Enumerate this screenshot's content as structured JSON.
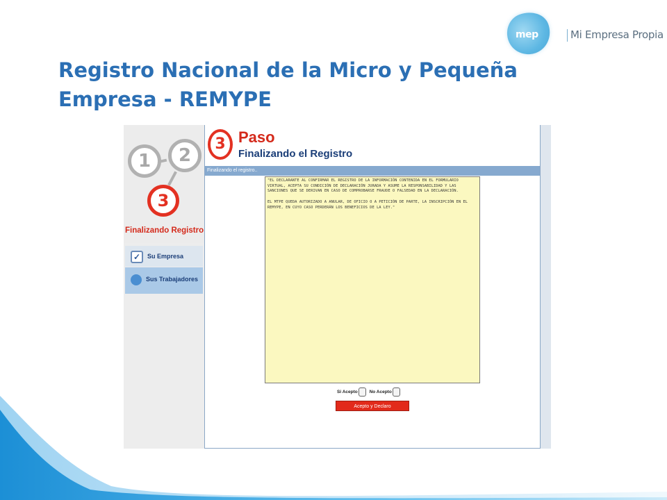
{
  "logo": {
    "short": "mep",
    "name": "Mi Empresa Propia"
  },
  "title": {
    "line1": "Registro Nacional de la Micro y Pequeña",
    "line2": "Empresa - REMYPE"
  },
  "colors": {
    "title": "#2b6fb4",
    "accent_red": "#e33122",
    "nav_blue": "#1b3e78"
  },
  "sidebar": {
    "steps": [
      "1",
      "2",
      "3"
    ],
    "current_step_label": "Finalizando Registro",
    "items": [
      {
        "label": "Su Empresa",
        "icon": "checkmark-icon"
      },
      {
        "label": "Sus Trabajadores",
        "icon": "person-icon"
      }
    ]
  },
  "main": {
    "step_number": "3",
    "heading": "Paso",
    "subheading": "Finalizando el Registro",
    "section_bar": "Finalizando el registro..",
    "declaration": "\"EL DECLARANTE AL CONFIRMAR EL REGISTRO DE LA INFORMACIÓN CONTENIDA EN EL FORMULARIO VIRTUAL, ACEPTA SU CONDICIÓN DE DECLARACIÓN JURADA Y ASUME LA RESPONSABILIDAD Y LAS SANCIONES QUE SE DERIVAN EN CASO DE COMPROBARSE FRAUDE O FALSEDAD EN LA DECLARACIÓN.\n\nEL MTPE QUEDA AUTORIZADO A ANULAR, DE OFICIO O A PETICIÓN DE PARTE, LA INSCRIPCIÓN EN EL REMYPE, EN CUYO CASO PERDERÁN LOS BENEFICIOS DE LA LEY.\"",
    "accept_yes": "Si Acepto",
    "accept_no": "No Acepto",
    "submit_label": "Acepto y Declaro"
  }
}
